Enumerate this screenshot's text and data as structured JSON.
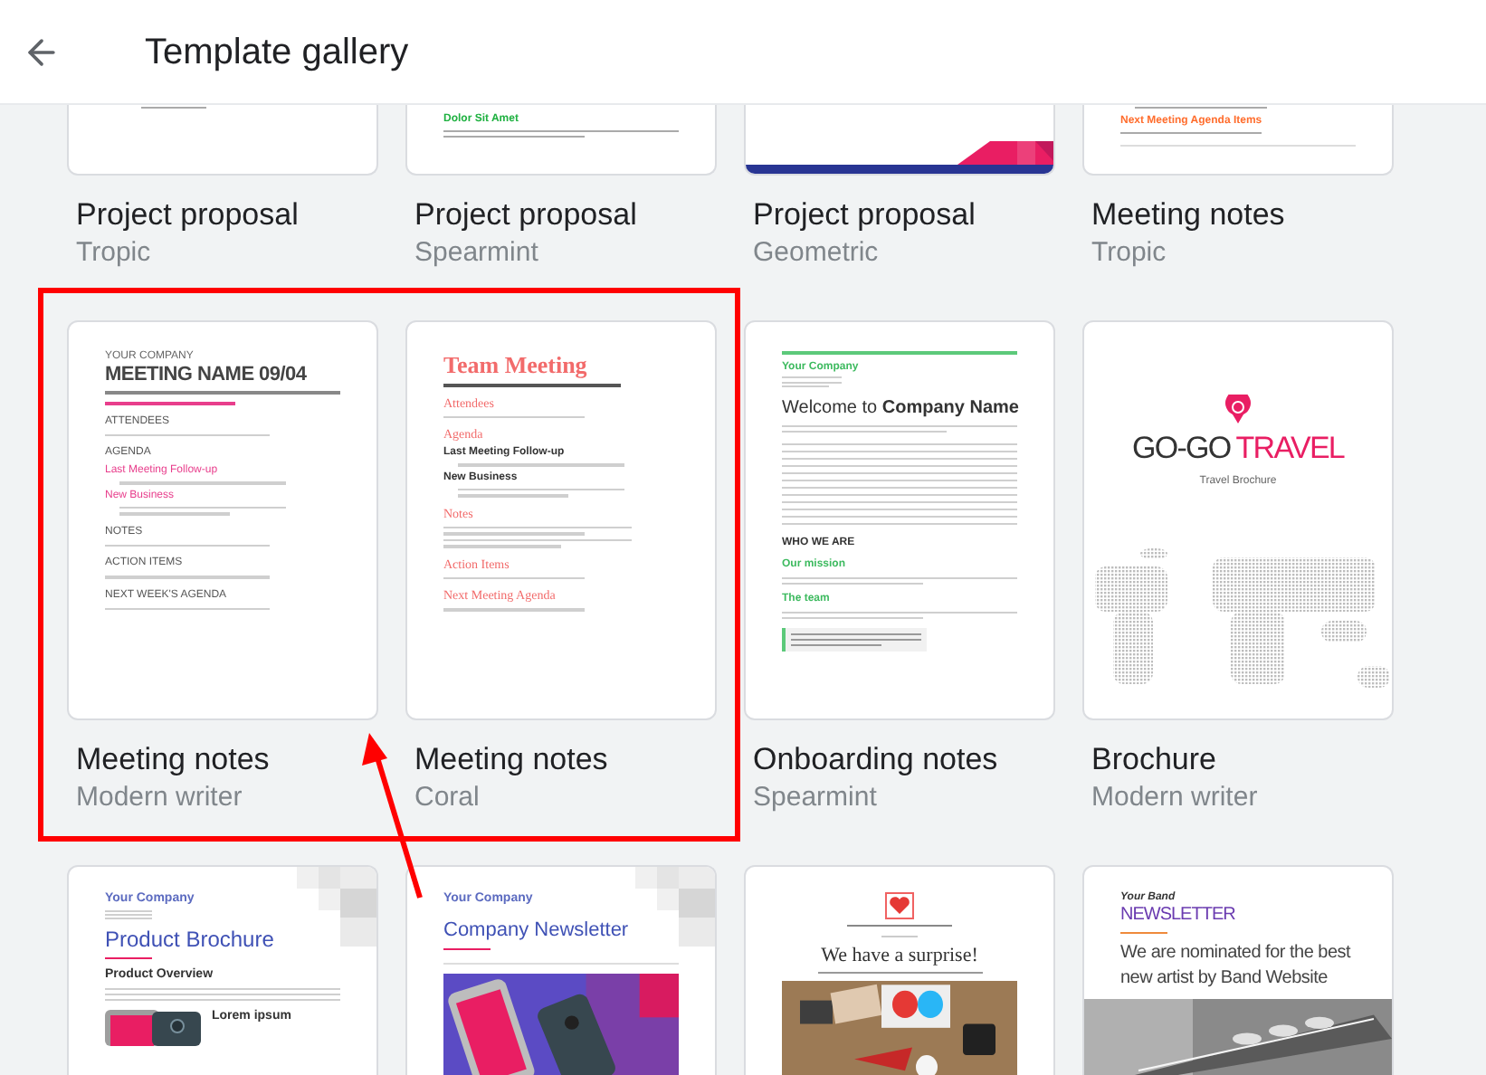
{
  "header": {
    "title": "Template gallery"
  },
  "rows": [
    {
      "cards": [
        {
          "title": "Project proposal",
          "subtitle": "Tropic",
          "thumb": {
            "kind": "tropic-proposal-end"
          }
        },
        {
          "title": "Project proposal",
          "subtitle": "Spearmint",
          "thumb": {
            "kind": "spearmint-proposal-end",
            "heading": "Dolor Sit Amet"
          }
        },
        {
          "title": "Project proposal",
          "subtitle": "Geometric",
          "thumb": {
            "kind": "geometric-proposal-end"
          }
        },
        {
          "title": "Meeting notes",
          "subtitle": "Tropic",
          "thumb": {
            "kind": "tropic-notes-end",
            "heading": "Next Meeting Agenda Items"
          }
        }
      ]
    },
    {
      "cards": [
        {
          "title": "Meeting notes",
          "subtitle": "Modern writer",
          "thumb": {
            "kind": "modern-notes",
            "company": "YOUR COMPANY",
            "title": "MEETING NAME 09/04",
            "sections": [
              {
                "heading": "ATTENDEES"
              },
              {
                "heading": "AGENDA",
                "subs": [
                  "Last Meeting Follow-up",
                  "New Business"
                ]
              },
              {
                "heading": "NOTES"
              },
              {
                "heading": "ACTION ITEMS"
              },
              {
                "heading": "NEXT WEEK'S AGENDA"
              }
            ]
          }
        },
        {
          "title": "Meeting notes",
          "subtitle": "Coral",
          "thumb": {
            "kind": "coral-notes",
            "title": "Team Meeting",
            "sections": [
              {
                "heading": "Attendees"
              },
              {
                "heading": "Agenda",
                "subs": [
                  "Last Meeting Follow-up",
                  "New Business"
                ]
              },
              {
                "heading": "Notes"
              },
              {
                "heading": "Action Items"
              },
              {
                "heading": "Next Meeting Agenda"
              }
            ]
          }
        },
        {
          "title": "Onboarding notes",
          "subtitle": "Spearmint",
          "thumb": {
            "kind": "spearmint-onboarding",
            "company": "Your Company",
            "title": "Welcome to **Company Name**",
            "section": "WHO WE ARE",
            "subs": [
              "Our mission",
              "The team"
            ]
          }
        },
        {
          "title": "Brochure",
          "subtitle": "Modern writer",
          "thumb": {
            "kind": "travel-brochure",
            "brand": "GO-GO",
            "brand_accent": "TRAVEL",
            "tagline": "Travel Brochure"
          }
        }
      ]
    },
    {
      "cards": [
        {
          "thumb": {
            "kind": "product-brochure",
            "company": "Your Company",
            "title": "Product Brochure",
            "section": "Product Overview",
            "aside": "Lorem ipsum"
          }
        },
        {
          "thumb": {
            "kind": "company-newsletter",
            "company": "Your Company",
            "title": "Company Newsletter"
          }
        },
        {
          "thumb": {
            "kind": "surprise-newsletter",
            "title": "We have a surprise!"
          }
        },
        {
          "thumb": {
            "kind": "band-newsletter",
            "band": "Your Band",
            "title": "NEWSLETTER",
            "headline": "We are nominated for the best new artist by Band Website"
          }
        }
      ]
    }
  ]
}
